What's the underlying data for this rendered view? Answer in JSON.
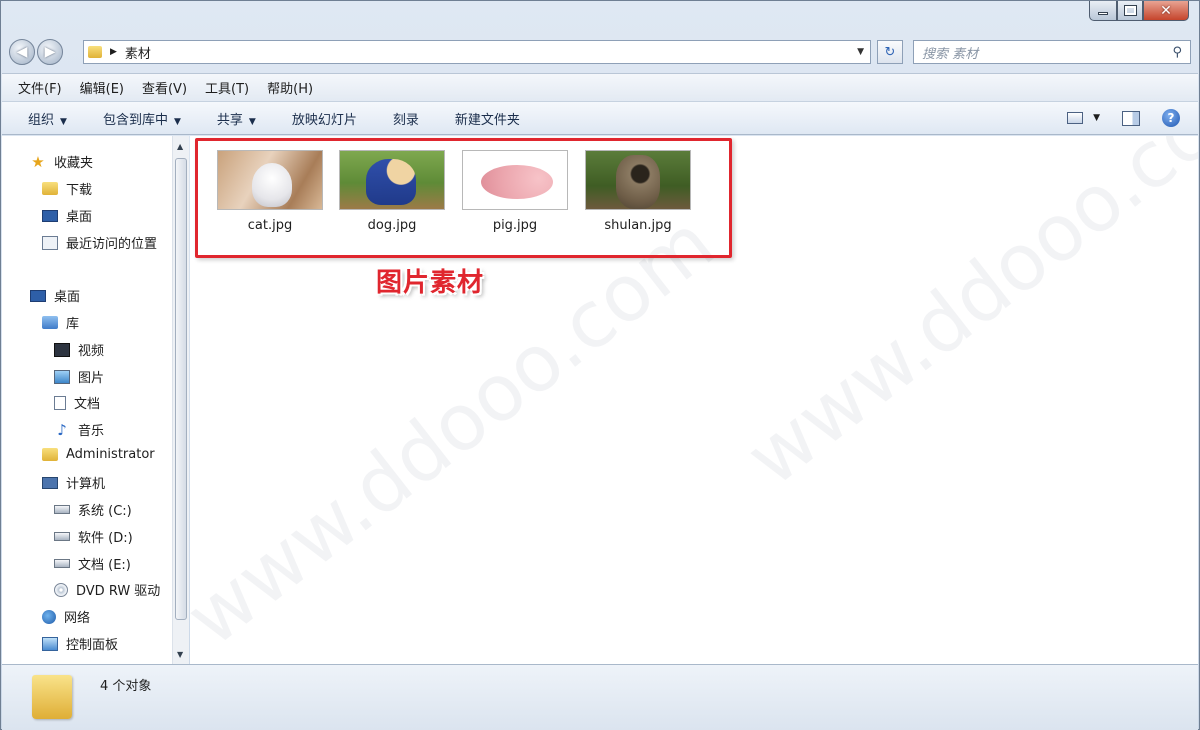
{
  "window": {
    "minimize_glyph": "minimize-icon",
    "maximize_glyph": "maximize-icon",
    "close_glyph": "✕"
  },
  "address": {
    "back": "◀",
    "forward": "▶",
    "path_sep": "▶",
    "path": "素材",
    "dropdown": "▼",
    "refresh": "↻"
  },
  "search": {
    "placeholder": "搜索 素材",
    "icon": "search-icon"
  },
  "menu": [
    "文件(F)",
    "编辑(E)",
    "查看(V)",
    "工具(T)",
    "帮助(H)"
  ],
  "commands": {
    "organize": "组织",
    "include_in_library": "包含到库中",
    "share": "共享",
    "slideshow": "放映幻灯片",
    "burn": "刻录",
    "new_folder": "新建文件夹",
    "dropdown": "▼"
  },
  "nav": {
    "favorites": "收藏夹",
    "downloads": "下载",
    "desktop_fav": "桌面",
    "recent": "最近访问的位置",
    "desktop": "桌面",
    "libraries": "库",
    "videos": "视频",
    "pictures": "图片",
    "documents": "文档",
    "music": "音乐",
    "administrator": "Administrator",
    "computer": "计算机",
    "drive_c": "系统 (C:)",
    "drive_d": "软件 (D:)",
    "drive_e": "文档 (E:)",
    "dvd": "DVD RW 驱动",
    "network": "网络",
    "control_panel": "控制面板"
  },
  "files": [
    {
      "name": "cat.jpg",
      "thumb": "cat"
    },
    {
      "name": "dog.jpg",
      "thumb": "dog"
    },
    {
      "name": "pig.jpg",
      "thumb": "pig"
    },
    {
      "name": "shulan.jpg",
      "thumb": "sloth"
    }
  ],
  "annotation": "图片素材",
  "watermark": "www.ddooo.com",
  "status": {
    "count": "4 个对象"
  },
  "colors": {
    "annotation_red": "#e0262e",
    "help_blue": "#1f56b0"
  }
}
